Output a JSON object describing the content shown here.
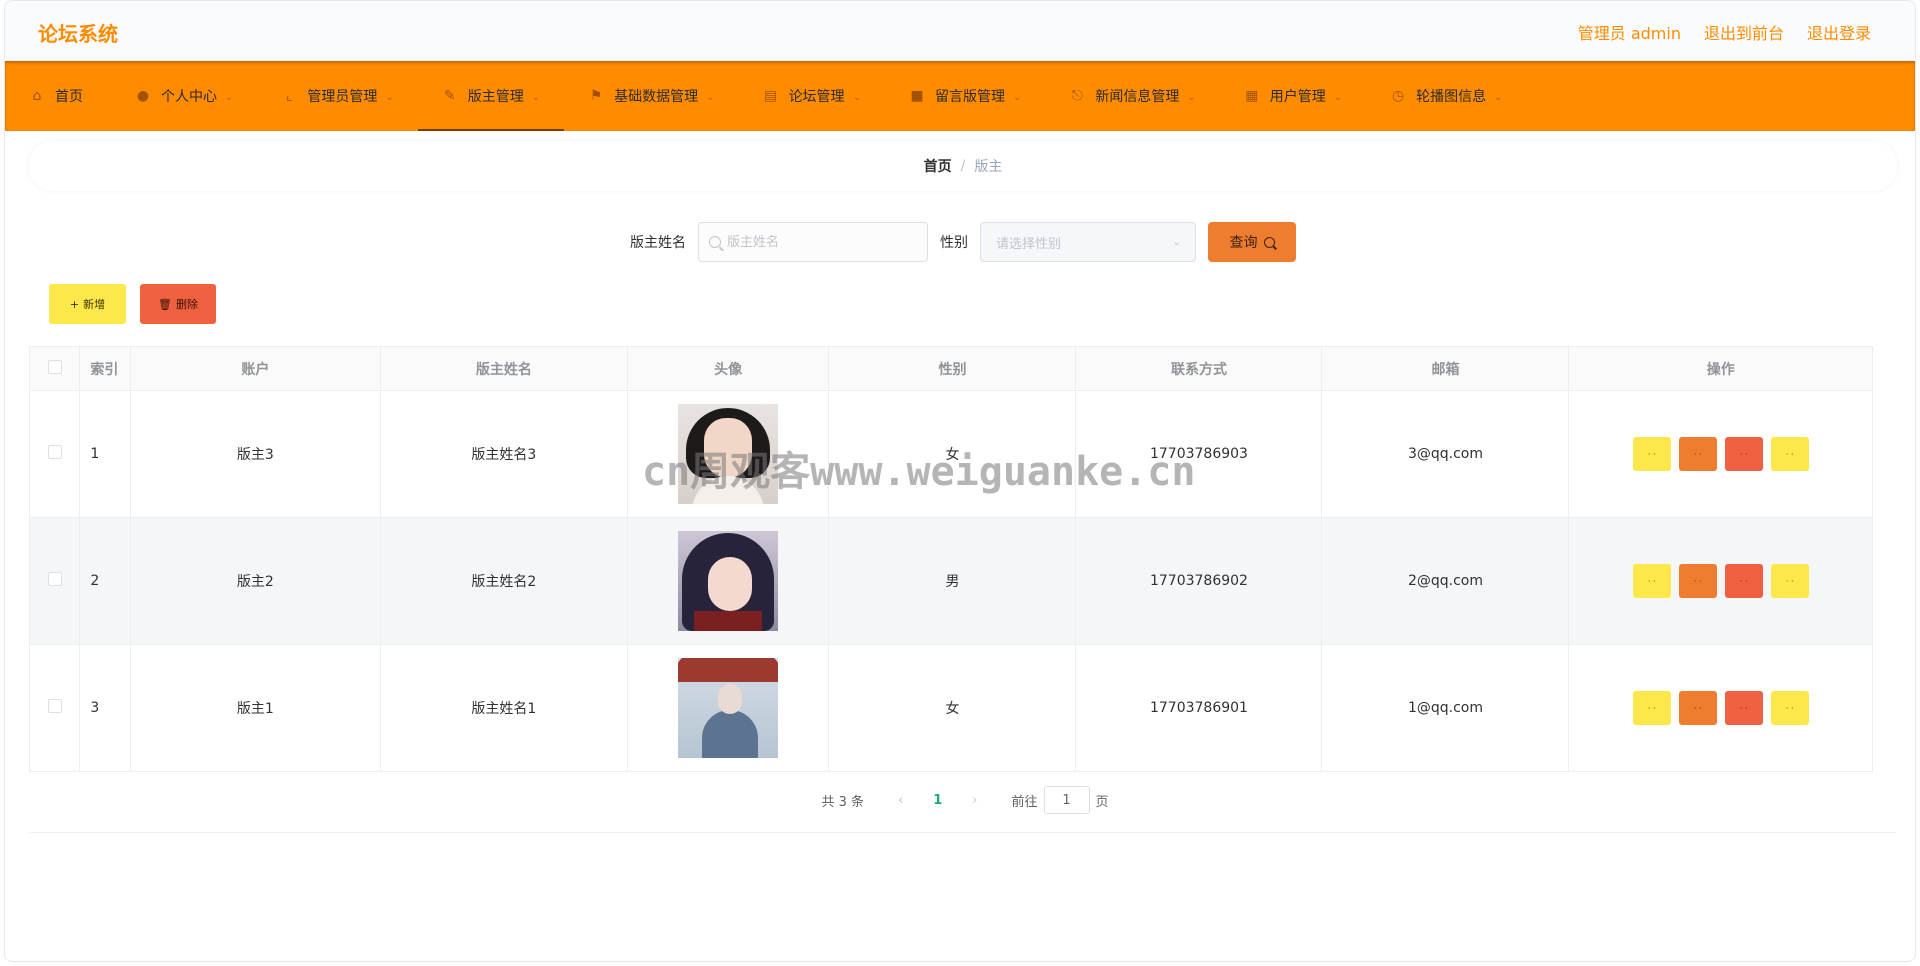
{
  "header": {
    "brand": "论坛系统",
    "user_label": "管理员 admin",
    "to_front": "退出到前台",
    "logout": "退出登录"
  },
  "nav": {
    "items": [
      {
        "label": "首页",
        "icon": "home-icon"
      },
      {
        "label": "个人中心",
        "icon": "user-icon"
      },
      {
        "label": "管理员管理",
        "icon": "crop-icon"
      },
      {
        "label": "版主管理",
        "icon": "edit-icon"
      },
      {
        "label": "基础数据管理",
        "icon": "flag-icon"
      },
      {
        "label": "论坛管理",
        "icon": "document-icon"
      },
      {
        "label": "留言版管理",
        "icon": "folder-icon"
      },
      {
        "label": "新闻信息管理",
        "icon": "mic-icon"
      },
      {
        "label": "用户管理",
        "icon": "calendar-icon"
      },
      {
        "label": "轮播图信息",
        "icon": "clock-icon"
      }
    ],
    "active_index": 3
  },
  "breadcrumb": {
    "home": "首页",
    "separator": "/",
    "current": "版主"
  },
  "search": {
    "name_label": "版主姓名",
    "name_placeholder": "版主姓名",
    "gender_label": "性别",
    "gender_placeholder": "请选择性别",
    "query_label": "查询"
  },
  "actions": {
    "add_label": "新增",
    "delete_label": "删除"
  },
  "table": {
    "columns": [
      "索引",
      "账户",
      "版主姓名",
      "头像",
      "性别",
      "联系方式",
      "邮箱",
      "操作"
    ],
    "rows": [
      {
        "index": "1",
        "account": "版主3",
        "name": "版主姓名3",
        "gender": "女",
        "phone": "17703786903",
        "email": "3@qq.com"
      },
      {
        "index": "2",
        "account": "版主2",
        "name": "版主姓名2",
        "gender": "男",
        "phone": "17703786902",
        "email": "2@qq.com"
      },
      {
        "index": "3",
        "account": "版主1",
        "name": "版主姓名1",
        "gender": "女",
        "phone": "17703786901",
        "email": "1@qq.com"
      }
    ]
  },
  "pagination": {
    "total_text": "共 3 条",
    "current_page": "1",
    "goto_prefix": "前往",
    "goto_value": "1",
    "goto_suffix": "页"
  },
  "watermark": "cn周观客www.weiguanke.cn",
  "colors": {
    "accent": "#ff8c00",
    "yellow_button": "#fde84b",
    "orange_button": "#ef7d30",
    "red_button": "#ee6040",
    "page_active": "#1fa67a"
  }
}
